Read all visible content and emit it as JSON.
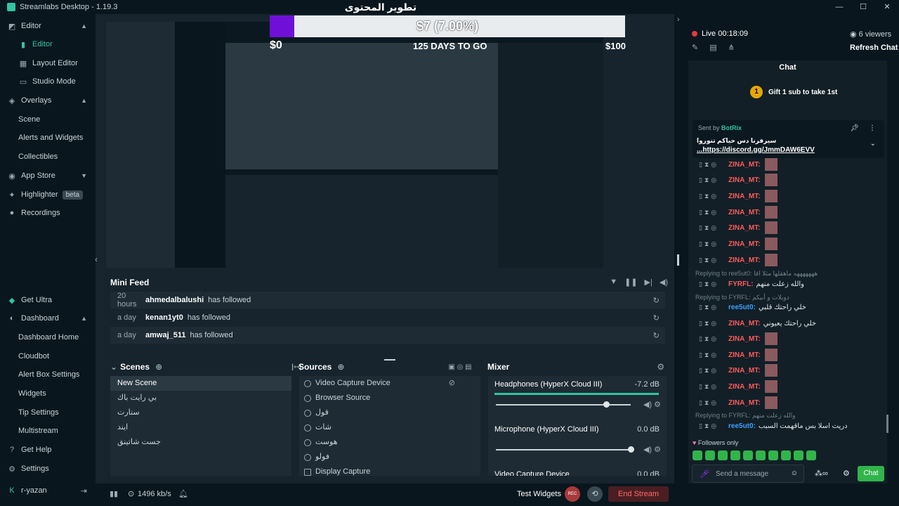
{
  "window": {
    "title": "Streamlabs Desktop - 1.19.3",
    "controls": [
      "—",
      "☐",
      "✕"
    ]
  },
  "nav": {
    "items": [
      {
        "label": "Editor",
        "icon": "editor-icon",
        "type": "group"
      },
      {
        "label": "Editor",
        "icon": "editor-sub-icon",
        "type": "sub",
        "active": true
      },
      {
        "label": "Layout Editor",
        "icon": "layout-icon",
        "type": "sub"
      },
      {
        "label": "Studio Mode",
        "icon": "studio-icon",
        "type": "sub"
      },
      {
        "label": "Overlays",
        "icon": "overlays-icon",
        "type": "group"
      },
      {
        "label": "Scene",
        "type": "sub"
      },
      {
        "label": "Alerts and Widgets",
        "type": "sub"
      },
      {
        "label": "Collectibles",
        "type": "sub"
      },
      {
        "label": "App Store",
        "icon": "appstore-icon",
        "type": "group"
      },
      {
        "label": "Highlighter",
        "icon": "highlighter-icon",
        "type": "item",
        "badge": "beta"
      },
      {
        "label": "Recordings",
        "icon": "recordings-icon",
        "type": "item"
      },
      {
        "label": "Get Ultra",
        "icon": "ultra-icon",
        "type": "item"
      },
      {
        "label": "Dashboard",
        "icon": "dashboard-icon",
        "type": "group"
      },
      {
        "label": "Dashboard Home",
        "type": "sub"
      },
      {
        "label": "Cloudbot",
        "type": "sub"
      },
      {
        "label": "Alert Box Settings",
        "type": "sub"
      },
      {
        "label": "Widgets",
        "type": "sub"
      },
      {
        "label": "Tip Settings",
        "type": "sub"
      },
      {
        "label": "Multistream",
        "type": "sub"
      },
      {
        "label": "Get Help",
        "icon": "help-icon",
        "type": "item"
      },
      {
        "label": "Settings",
        "icon": "gear-icon",
        "type": "item"
      },
      {
        "label": "r-yazan",
        "icon": "kick-icon",
        "type": "user"
      }
    ]
  },
  "overlay": {
    "title": "تطوير المحتوى",
    "goal_text": "$7 (7.00%)",
    "goal_progress": 0.07,
    "goal_start": "$0",
    "goal_days": "125 DAYS TO GO",
    "goal_end": "$100",
    "fill_color": "#6f0fd8"
  },
  "minifeed": {
    "title": "Mini Feed",
    "rows": [
      {
        "time": "20 hours",
        "user": "ahmedalbalushi",
        "action": "has followed"
      },
      {
        "time": "a day",
        "user": "kenan1yt0",
        "action": "has followed"
      },
      {
        "time": "a day",
        "user": "amwaj_511",
        "action": "has followed"
      }
    ]
  },
  "scenes": {
    "title": "Scenes",
    "items": [
      "New Scene",
      "بي رايت باك",
      "ستارت",
      "ايند",
      "جست شاتينق"
    ]
  },
  "sources": {
    "title": "Sources",
    "items": [
      "Video Capture Device",
      "Browser Source",
      "قول",
      "شات",
      "هوست",
      "فولو",
      "Display Capture"
    ]
  },
  "mixer": {
    "title": "Mixer",
    "channels": [
      {
        "name": "Headphones (HyperX Cloud III)",
        "db": "-7.2 dB",
        "level": 0.82
      },
      {
        "name": "Microphone (HyperX Cloud III)",
        "db": "0.0 dB",
        "level": 1.0
      },
      {
        "name": "Video Capture Device",
        "db": "0.0 dB",
        "level": 1.0
      }
    ]
  },
  "footer": {
    "bitrate": "1496 kb/s",
    "test_widgets": "Test Widgets",
    "rec_label": "REC",
    "end_stream": "End Stream"
  },
  "right": {
    "live": "Live 00:18:09",
    "viewers": "6 viewers",
    "refresh": "Refresh Chat",
    "chat_title": "Chat",
    "gift_text": "Gift 1 sub to take 1st",
    "gift_rank": "1",
    "pinned": {
      "sent_by": "Sent by",
      "bot": "BotRix",
      "line1": "سيرفرنا دس حياكم تنوروا",
      "line2": "...https://discord.gg/JmmDAW6EVV"
    },
    "lines": [
      {
        "nick": "ZINA_MT:",
        "color": "#ff5a5a",
        "text": ""
      },
      {
        "nick": "ZINA_MT:",
        "color": "#ff5a5a",
        "text": ""
      },
      {
        "nick": "ZINA_MT:",
        "color": "#ff5a5a",
        "text": ""
      },
      {
        "nick": "ZINA_MT:",
        "color": "#ff5a5a",
        "text": ""
      },
      {
        "nick": "ZINA_MT:",
        "color": "#ff5a5a",
        "text": ""
      },
      {
        "nick": "ZINA_MT:",
        "color": "#ff5a5a",
        "text": ""
      },
      {
        "nick": "ZINA_MT:",
        "color": "#ff5a5a",
        "text": ""
      }
    ],
    "reply1": "Replying to ree5ut0: هههههههه ماهقلها مثلا اقا",
    "line_fyrfl": {
      "nick": "FYRFL:",
      "color": "#ff5a5a",
      "text": "والله زعلت منهم"
    },
    "reply2": "Replying to FYRFL: دويلات و أبيكم",
    "line_ree1": {
      "nick": "ree5ut0:",
      "color": "#3aa0ff",
      "text": "خلي راحتك قلبي"
    },
    "line_zina_text": {
      "nick": "ZINA_MT:",
      "color": "#ff5a5a",
      "text": "خلي راحتك يعيوني"
    },
    "lines2": [
      {
        "nick": "ZINA_MT:",
        "color": "#ff5a5a",
        "text": ""
      },
      {
        "nick": "ZINA_MT:",
        "color": "#ff5a5a",
        "text": ""
      },
      {
        "nick": "ZINA_MT:",
        "color": "#ff5a5a",
        "text": ""
      },
      {
        "nick": "ZINA_MT:",
        "color": "#ff5a5a",
        "text": ""
      },
      {
        "nick": "ZINA_MT:",
        "color": "#ff5a5a",
        "text": ""
      }
    ],
    "reply3": "Replying to FYRFL: والله زعلت منهم",
    "line_ree2": {
      "nick": "ree5ut0:",
      "color": "#3aa0ff",
      "text": "دريت اسلا بس ماقهمت السبب"
    },
    "followers_only": "Followers only",
    "send_placeholder": "Send a message",
    "chat_button": "Chat"
  }
}
